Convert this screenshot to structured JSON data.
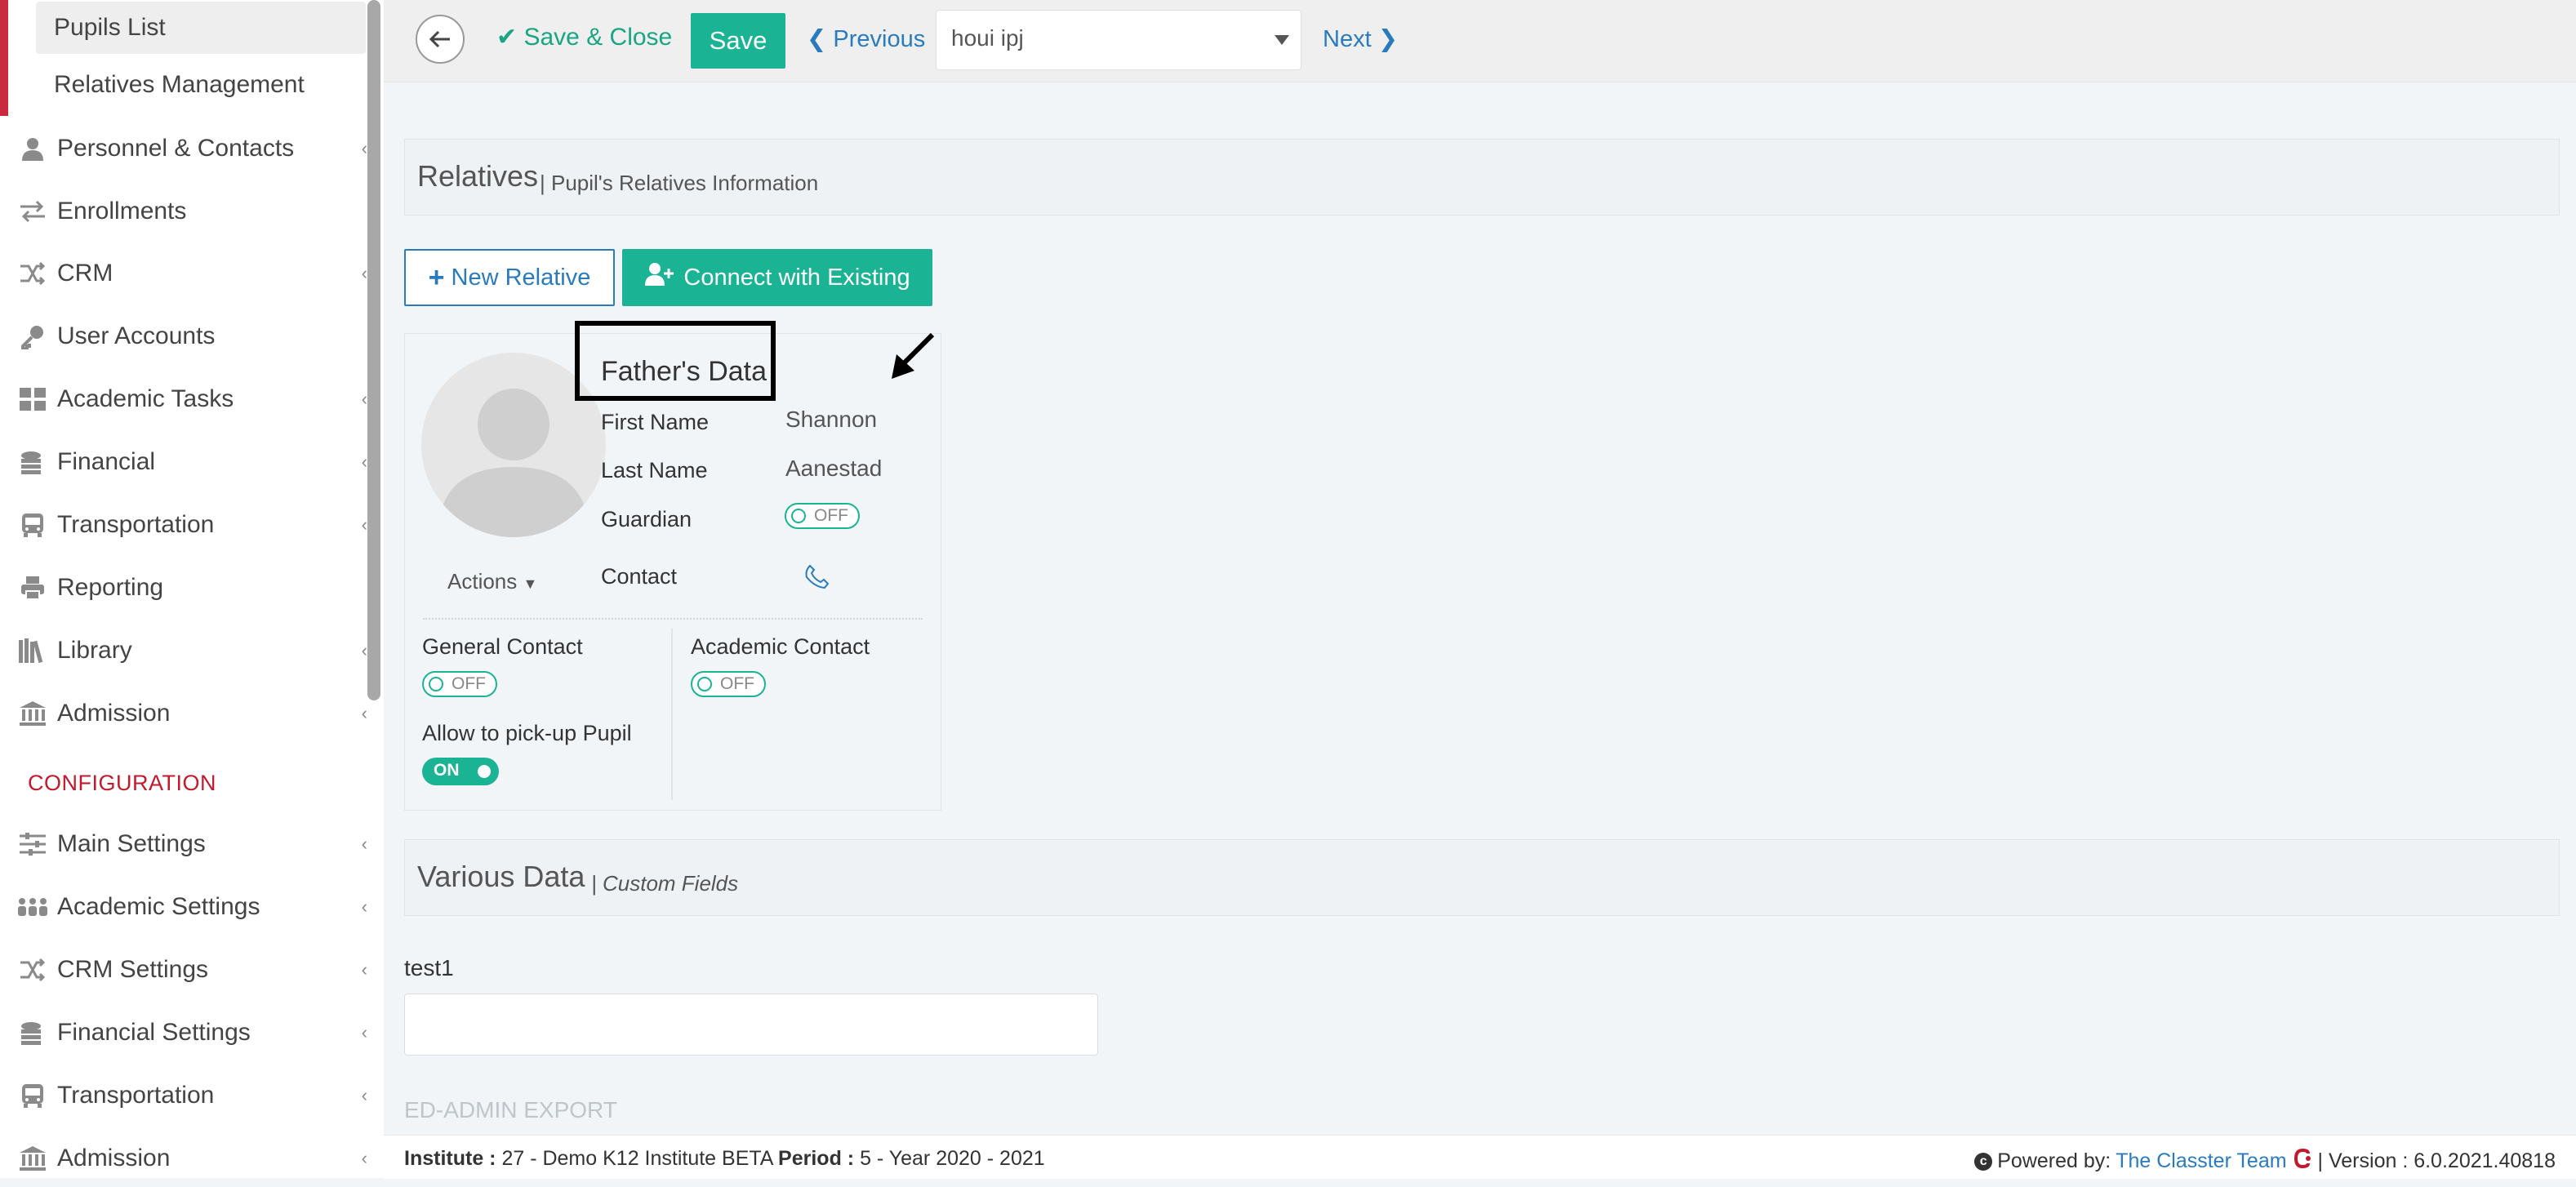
{
  "sidebar": {
    "sub_items": [
      {
        "label": "Pupils List"
      },
      {
        "label": "Relatives Management"
      }
    ],
    "items": [
      {
        "label": "Personnel & Contacts",
        "icon": "person-icon"
      },
      {
        "label": "Enrollments",
        "icon": "exchange-icon"
      },
      {
        "label": "CRM",
        "icon": "shuffle-icon"
      },
      {
        "label": "User Accounts",
        "icon": "key-icon"
      },
      {
        "label": "Academic Tasks",
        "icon": "grid-icon"
      },
      {
        "label": "Financial",
        "icon": "coins-icon"
      },
      {
        "label": "Transportation",
        "icon": "bus-icon"
      },
      {
        "label": "Reporting",
        "icon": "printer-icon"
      },
      {
        "label": "Library",
        "icon": "books-icon"
      },
      {
        "label": "Admission",
        "icon": "institution-icon"
      }
    ],
    "config_title": "CONFIGURATION",
    "config_items": [
      {
        "label": "Main Settings",
        "icon": "sliders-icon"
      },
      {
        "label": "Academic Settings",
        "icon": "users-group-icon"
      },
      {
        "label": "CRM Settings",
        "icon": "shuffle-icon"
      },
      {
        "label": "Financial Settings",
        "icon": "coins-icon"
      },
      {
        "label": "Transportation",
        "icon": "bus-icon"
      },
      {
        "label": "Admission",
        "icon": "institution-icon"
      }
    ]
  },
  "toolbar": {
    "save_close_label": "Save & Close",
    "save_label": "Save",
    "previous_label": "Previous",
    "select_value": "houi ipj",
    "next_label": "Next"
  },
  "relatives": {
    "title": "Relatives",
    "subtitle": "Pupil's Relatives Information",
    "new_relative_label": "New Relative",
    "connect_label": "Connect with Existing"
  },
  "card": {
    "title": "Father's Data",
    "first_name_label": "First Name",
    "first_name_value": "Shannon",
    "last_name_label": "Last Name",
    "last_name_value": "Aanestad",
    "guardian_label": "Guardian",
    "guardian_toggle": "OFF",
    "contact_label": "Contact",
    "actions_label": "Actions",
    "general_contact_label": "General Contact",
    "general_contact_toggle": "OFF",
    "academic_contact_label": "Academic Contact",
    "academic_contact_toggle": "OFF",
    "pickup_label": "Allow to pick-up Pupil",
    "pickup_toggle": "ON"
  },
  "various": {
    "title": "Various Data",
    "subtitle": "Custom Fields",
    "field_label": "test1",
    "field_value": "",
    "export_label": "ED-ADMIN EXPORT"
  },
  "footer": {
    "institute_label": "Institute :",
    "institute_value": "27 - Demo K12 Institute BETA",
    "period_label": "Period :",
    "period_value": "5 - Year 2020 - 2021",
    "powered_label": "Powered by:",
    "powered_link": "The Classter Team",
    "version_text": "| Version : 6.0.2021.40818"
  },
  "colors": {
    "accent_green": "#1ab394",
    "link_blue": "#2a7bbd",
    "brand_red": "#c4192c"
  }
}
